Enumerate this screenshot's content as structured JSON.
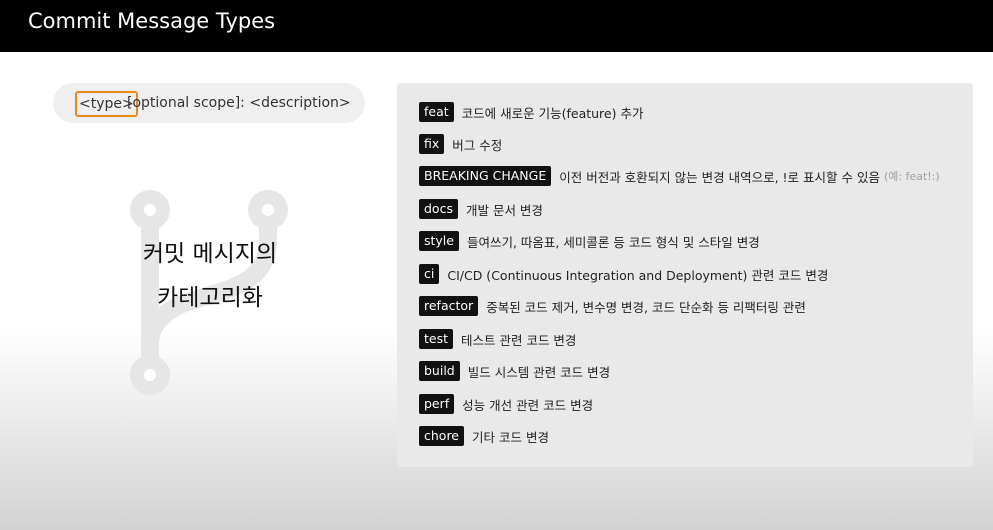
{
  "slide": {
    "title": "Commit Message Types"
  },
  "format": {
    "type_token": "<type>",
    "rest": "[optional scope]: <description>",
    "highlight_color": "#e8891e"
  },
  "category": {
    "line1": "커밋 메시지의",
    "line2": "카테고리화",
    "icon": "git-branch-icon"
  },
  "types": [
    {
      "tag": "feat",
      "desc": "코드에 새로운 기능(feature) 추가"
    },
    {
      "tag": "fix",
      "desc": "버그 수정"
    },
    {
      "tag": "BREAKING CHANGE",
      "desc": "이전 버전과 호환되지 않는 변경 내역으로, !로 표시할 수 있음",
      "example": "(예: feat!:)"
    },
    {
      "tag": "docs",
      "desc": "개발 문서 변경"
    },
    {
      "tag": "style",
      "desc": "들여쓰기, 따옴표, 세미콜론 등 코드 형식 및 스타일 변경"
    },
    {
      "tag": "ci",
      "desc": "CI/CD (Continuous Integration and Deployment) 관련 코드 변경"
    },
    {
      "tag": "refactor",
      "desc": "중복된 코드 제거, 변수명 변경, 코드 단순화 등 리팩터링 관련"
    },
    {
      "tag": "test",
      "desc": "테스트 관련 코드 변경"
    },
    {
      "tag": "build",
      "desc": "빌드 시스템 관련 코드 변경"
    },
    {
      "tag": "perf",
      "desc": "성능 개선 관련 코드 변경"
    },
    {
      "tag": "chore",
      "desc": "기타 코드 변경"
    }
  ]
}
